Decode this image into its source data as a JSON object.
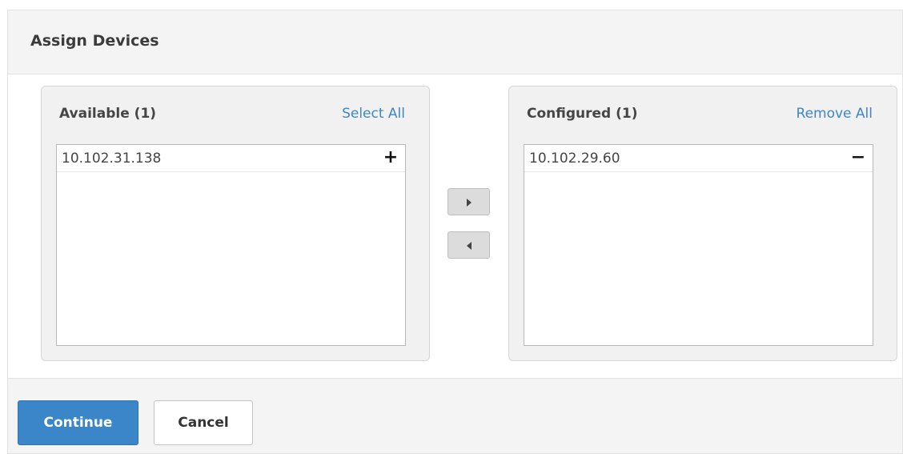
{
  "dialog": {
    "title": "Assign Devices"
  },
  "available": {
    "title": "Available (1)",
    "action_label": "Select All",
    "items": [
      {
        "label": "10.102.31.138",
        "action_icon": "plus-icon",
        "action_glyph": "+"
      }
    ]
  },
  "configured": {
    "title": "Configured (1)",
    "action_label": "Remove All",
    "items": [
      {
        "label": "10.102.29.60",
        "action_icon": "minus-icon",
        "action_glyph": "−"
      }
    ]
  },
  "transfer": {
    "move_right_icon": "caret-right-icon",
    "move_left_icon": "caret-left-icon"
  },
  "footer": {
    "continue_label": "Continue",
    "cancel_label": "Cancel"
  },
  "colors": {
    "primary": "#3a86c8",
    "link": "#3f86c6",
    "panel_bg": "#f1f1f1",
    "header_bg": "#f4f4f4"
  }
}
